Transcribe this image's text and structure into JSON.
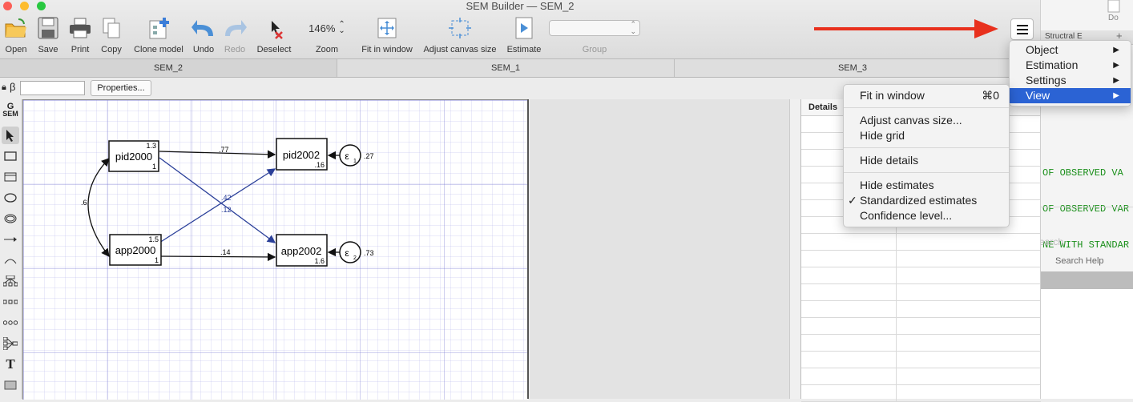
{
  "window": {
    "title": "SEM Builder — SEM_2"
  },
  "toolbar": {
    "open": "Open",
    "save": "Save",
    "print": "Print",
    "copy": "Copy",
    "clone": "Clone model",
    "undo": "Undo",
    "redo": "Redo",
    "deselect": "Deselect",
    "zoom_value": "146%",
    "zoom": "Zoom",
    "fit": "Fit in window",
    "adjust": "Adjust canvas size",
    "estimate": "Estimate",
    "group": "Group"
  },
  "tabs": [
    "SEM_2",
    "SEM_1",
    "SEM_3"
  ],
  "propbar": {
    "lock_beta": "β",
    "properties_button": "Properties..."
  },
  "palette": {
    "gsem_top": "G",
    "gsem_bottom": "SEM",
    "text_tool": "T"
  },
  "diagram": {
    "nodes": {
      "pid2000": {
        "label": "pid2000",
        "top_value": "1.3",
        "bottom_value": "1"
      },
      "app2000": {
        "label": "app2000",
        "top_value": "1.5",
        "bottom_value": "1"
      },
      "pid2002": {
        "label": "pid2002",
        "bottom_value": ".16"
      },
      "app2002": {
        "label": "app2002",
        "bottom_value": "1.6"
      }
    },
    "errors": {
      "e1": {
        "symbol": "ε",
        "sub": "1",
        "value": ".27"
      },
      "e2": {
        "symbol": "ε",
        "sub": "2",
        "value": ".73"
      }
    },
    "paths": {
      "covariance": ".6",
      "pid_pid": ".77",
      "app_app": ".14",
      "app_pid": ".42",
      "pid_app": ".12"
    }
  },
  "details": {
    "header": "Details"
  },
  "right_pane": {
    "top_label": "Do",
    "tab_label": "Structral E",
    "plus": "+",
    "code_lines": [
      "OF OBSERVED VA",
      "OF OBSERVED VAR",
      "NE WITH STANDAR"
    ],
    "search_placeholder": "earch",
    "search_help": "Search Help"
  },
  "main_menu": {
    "items": [
      "Object",
      "Estimation",
      "Settings",
      "View"
    ],
    "highlighted": "View",
    "highlight_color": "#2b63d4"
  },
  "view_submenu": {
    "fit": "Fit in window",
    "fit_shortcut": "⌘0",
    "adjust": "Adjust canvas size...",
    "hide_grid": "Hide grid",
    "hide_details": "Hide details",
    "hide_estimates": "Hide estimates",
    "standardized": "Standardized estimates",
    "standardized_checked": "✓",
    "confidence": "Confidence level..."
  },
  "annotation": {
    "arrow_color": "#e8301d"
  }
}
